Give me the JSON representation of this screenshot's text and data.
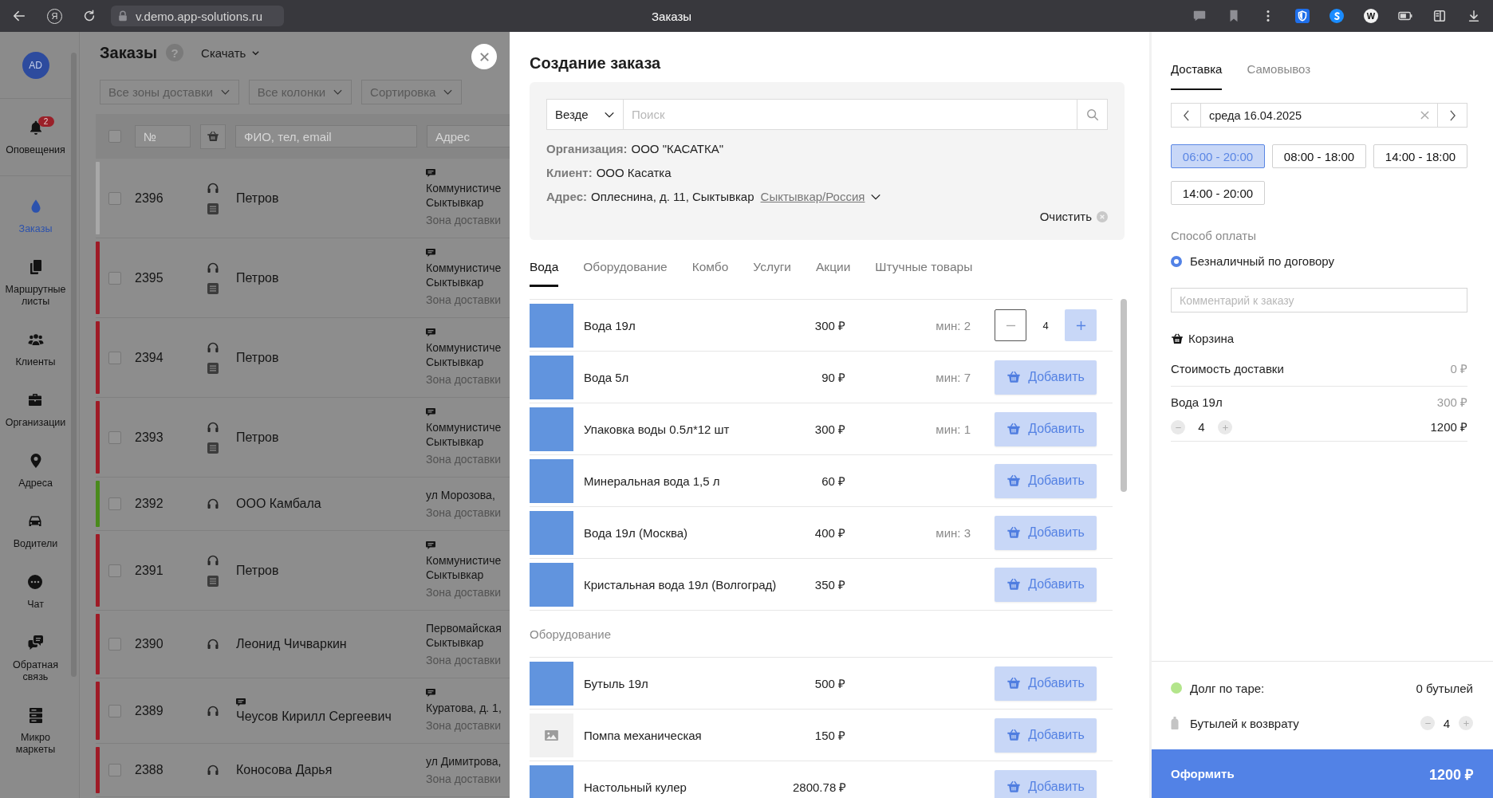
{
  "browser": {
    "logo": "Я",
    "url": "v.demo.app-solutions.ru",
    "title": "Заказы",
    "extension_letter": "W"
  },
  "sidebar": {
    "avatar": "AD",
    "items": [
      {
        "kind": "bell",
        "label": "Оповещения",
        "badge": "2",
        "selected": false
      },
      {
        "kind": "drop",
        "label": "Заказы",
        "selected": true
      },
      {
        "kind": "sheets",
        "label": "Маршрутные листы",
        "selected": false
      },
      {
        "kind": "people",
        "label": "Клиенты",
        "selected": false
      },
      {
        "kind": "briefcase",
        "label": "Организации",
        "selected": false
      },
      {
        "kind": "pin",
        "label": "Адреса",
        "selected": false
      },
      {
        "kind": "car",
        "label": "Водители",
        "selected": false
      },
      {
        "kind": "chat",
        "label": "Чат",
        "selected": false
      },
      {
        "kind": "feedback",
        "label": "Обратная связь",
        "selected": false
      },
      {
        "kind": "server",
        "label": "Микро маркеты",
        "selected": false
      }
    ]
  },
  "page": {
    "title": "Заказы",
    "help": "?",
    "download": "Скачать",
    "filters": [
      "Все зоны доставки",
      "Все колонки",
      "Сортировка"
    ],
    "table": {
      "select_all_checked": false,
      "number_placeholder": "№",
      "name_placeholder": "ФИО, тел, email",
      "address_placeholder": "Адрес",
      "rows": [
        {
          "number": "2396",
          "color": "#a8a8a8",
          "checked": false,
          "list_icon": true,
          "name_note": false,
          "name": "Петров",
          "address_note": true,
          "address": [
            "Коммунистиче",
            "Сыктывкар"
          ],
          "zone": "Зона доставки"
        },
        {
          "number": "2395",
          "color": "#9e1b26",
          "checked": false,
          "list_icon": true,
          "name_note": false,
          "name": "Петров",
          "address_note": true,
          "address": [
            "Коммунистиче",
            "Сыктывкар"
          ],
          "zone": "Зона доставки"
        },
        {
          "number": "2394",
          "color": "#9e1b26",
          "checked": false,
          "list_icon": true,
          "name_note": false,
          "name": "Петров",
          "address_note": true,
          "address": [
            "Коммунистиче",
            "Сыктывкар"
          ],
          "zone": "Зона доставки"
        },
        {
          "number": "2393",
          "color": "#9e1b26",
          "checked": false,
          "list_icon": true,
          "name_note": false,
          "name": "Петров",
          "address_note": true,
          "address": [
            "Коммунистиче",
            "Сыктывкар"
          ],
          "zone": "Зона доставки"
        },
        {
          "number": "2392",
          "color": "#4a8a1c",
          "checked": false,
          "list_icon": false,
          "name_note": false,
          "name": "ООО Камбала",
          "address_note": false,
          "address": [
            "ул Морозова,"
          ],
          "zone": "Зона доставки"
        },
        {
          "number": "2391",
          "color": "#9e1b26",
          "checked": false,
          "list_icon": true,
          "name_note": false,
          "name": "Петров",
          "address_note": true,
          "address": [
            "Коммунистиче",
            "Сыктывкар"
          ],
          "zone": "Зона доставки"
        },
        {
          "number": "2390",
          "color": "#9e1b26",
          "checked": false,
          "list_icon": false,
          "name_note": false,
          "name": "Леонид Чичваркин",
          "address_note": false,
          "address": [
            "Первомайская",
            "Сыктывкар"
          ],
          "zone": "Зона доставки"
        },
        {
          "number": "2389",
          "color": "#9e1b26",
          "checked": false,
          "list_icon": false,
          "name_note": true,
          "name": "Чеусов Кирилл Сергеевич",
          "address_note": true,
          "address": [
            "Куратова, д. 1,"
          ],
          "zone": "Зона доставки"
        },
        {
          "number": "2388",
          "color": "#9e1b26",
          "checked": false,
          "list_icon": false,
          "name_note": false,
          "name": "Коносова Дарья",
          "address_note": false,
          "address": [
            "ул Димитрова,"
          ],
          "zone": "Зона доставки"
        }
      ]
    }
  },
  "order": {
    "title": "Создание заказа",
    "search": {
      "scope": "Везде",
      "placeholder": "Поиск"
    },
    "details": [
      {
        "label": "Организация:",
        "value": "ООО \"КАСАТКА\""
      },
      {
        "label": "Клиент:",
        "value": "ООО Касатка"
      },
      {
        "label": "Адрес:",
        "value": "Оплеснина, д. 11, Сыктывкар",
        "link": "Сыктывкар/Россия"
      }
    ],
    "clear": "Очистить",
    "tabs": [
      {
        "label": "Вода",
        "selected": true
      },
      {
        "label": "Оборудование",
        "selected": false
      },
      {
        "label": "Комбо",
        "selected": false
      },
      {
        "label": "Услуги",
        "selected": false
      },
      {
        "label": "Акции",
        "selected": false
      },
      {
        "label": "Штучные товары",
        "selected": false
      }
    ],
    "sections": [
      {
        "products": [
          {
            "photo": true,
            "name": "Вода 19л",
            "price": "300 ₽",
            "min": "мин: 2",
            "kind": "stepper",
            "quantity": "4"
          },
          {
            "photo": true,
            "name": "Вода 5л",
            "price": "90 ₽",
            "min": "мин: 7",
            "kind": "button",
            "button": "Добавить"
          },
          {
            "photo": true,
            "name": "Упаковка воды 0.5л*12 шт",
            "price": "300 ₽",
            "min": "мин: 1",
            "kind": "button",
            "button": "Добавить"
          },
          {
            "photo": true,
            "name": "Минеральная вода 1,5 л",
            "price": "60 ₽",
            "kind": "button",
            "button": "Добавить"
          },
          {
            "photo": true,
            "name": "Вода 19л (Москва)",
            "price": "400 ₽",
            "min": "мин: 3",
            "kind": "button",
            "button": "Добавить"
          },
          {
            "photo": true,
            "name": "Кристальная вода 19л (Волгоград)",
            "price": "350 ₽",
            "kind": "button",
            "button": "Добавить"
          }
        ]
      },
      {
        "title": "Оборудование",
        "products": [
          {
            "photo": true,
            "name": "Бутыль 19л",
            "price": "500 ₽",
            "kind": "button",
            "button": "Добавить"
          },
          {
            "photo": false,
            "name": "Помпа механическая",
            "price": "150 ₽",
            "kind": "button",
            "button": "Добавить"
          },
          {
            "photo": true,
            "name": "Настольный кулер",
            "price": "2800.78 ₽",
            "kind": "button",
            "button": "Добавить"
          }
        ]
      }
    ]
  },
  "delivery": {
    "tabs": [
      {
        "label": "Доставка",
        "selected": true
      },
      {
        "label": "Самовывоз",
        "selected": false
      }
    ],
    "date": "среда 16.04.2025",
    "time_slots": [
      {
        "label": "06:00 - 20:00",
        "selected": true
      },
      {
        "label": "08:00 - 18:00",
        "selected": false
      },
      {
        "label": "14:00 - 18:00",
        "selected": false
      },
      {
        "label": "14:00 - 20:00",
        "selected": false
      }
    ],
    "payment_title": "Способ оплаты",
    "payment_options": [
      {
        "label": "Безналичный по договору",
        "selected": true
      }
    ],
    "comment_placeholder": "Комментарий к заказу",
    "cart": {
      "title": "Корзина",
      "delivery_cost_label": "Стоимость доставки",
      "delivery_cost": "0 ₽",
      "items": [
        {
          "name": "Вода 19л",
          "price": "300 ₽",
          "quantity": "4",
          "total": "1200 ₽"
        }
      ]
    },
    "container_debt": {
      "label": "Долг по таре:",
      "value": "0 бутылей"
    },
    "bottles_return": {
      "label": "Бутылей к возврату",
      "quantity": "4"
    },
    "submit": {
      "label": "Оформить",
      "total": "1200 ₽"
    }
  }
}
